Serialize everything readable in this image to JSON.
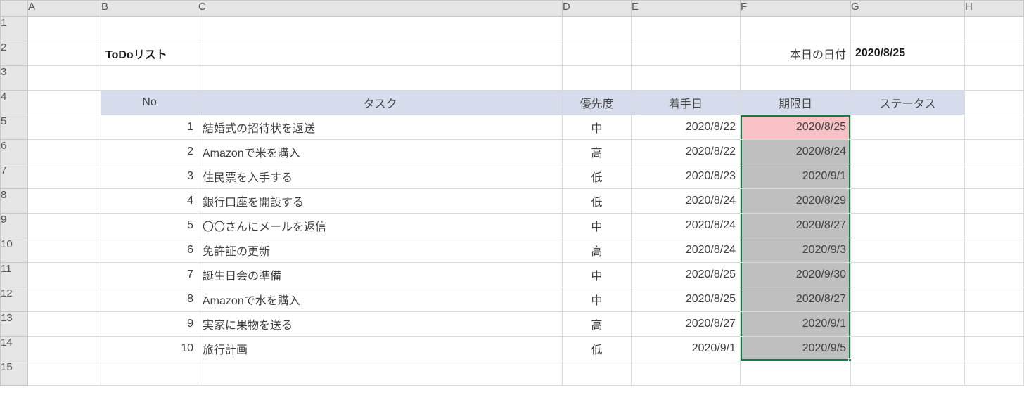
{
  "columns": [
    "A",
    "B",
    "C",
    "D",
    "E",
    "F",
    "G",
    "H"
  ],
  "rows": [
    "1",
    "2",
    "3",
    "4",
    "5",
    "6",
    "7",
    "8",
    "9",
    "10",
    "11",
    "12",
    "13",
    "14",
    "15"
  ],
  "title": "ToDoリスト",
  "today_label": "本日の日付",
  "today_value": "2020/8/25",
  "headers": {
    "no": "No",
    "task": "タスク",
    "priority": "優先度",
    "start": "着手日",
    "due": "期限日",
    "status": "ステータス"
  },
  "data": [
    {
      "no": "1",
      "task": "結婚式の招待状を返送",
      "priority": "中",
      "start": "2020/8/22",
      "due": "2020/8/25",
      "due_hl": "pink"
    },
    {
      "no": "2",
      "task": "Amazonで米を購入",
      "priority": "高",
      "start": "2020/8/22",
      "due": "2020/8/24",
      "due_hl": "gray"
    },
    {
      "no": "3",
      "task": "住民票を入手する",
      "priority": "低",
      "start": "2020/8/23",
      "due": "2020/9/1",
      "due_hl": "gray"
    },
    {
      "no": "4",
      "task": "銀行口座を開設する",
      "priority": "低",
      "start": "2020/8/24",
      "due": "2020/8/29",
      "due_hl": "gray"
    },
    {
      "no": "5",
      "task": "〇〇さんにメールを返信",
      "priority": "中",
      "start": "2020/8/24",
      "due": "2020/8/27",
      "due_hl": "gray"
    },
    {
      "no": "6",
      "task": "免許証の更新",
      "priority": "高",
      "start": "2020/8/24",
      "due": "2020/9/3",
      "due_hl": "gray"
    },
    {
      "no": "7",
      "task": "誕生日会の準備",
      "priority": "中",
      "start": "2020/8/25",
      "due": "2020/9/30",
      "due_hl": "gray"
    },
    {
      "no": "8",
      "task": "Amazonで水を購入",
      "priority": "中",
      "start": "2020/8/25",
      "due": "2020/8/27",
      "due_hl": "gray"
    },
    {
      "no": "9",
      "task": "実家に果物を送る",
      "priority": "高",
      "start": "2020/8/27",
      "due": "2020/9/1",
      "due_hl": "gray"
    },
    {
      "no": "10",
      "task": "旅行計画",
      "priority": "低",
      "start": "2020/9/1",
      "due": "2020/9/5",
      "due_hl": "gray"
    }
  ]
}
